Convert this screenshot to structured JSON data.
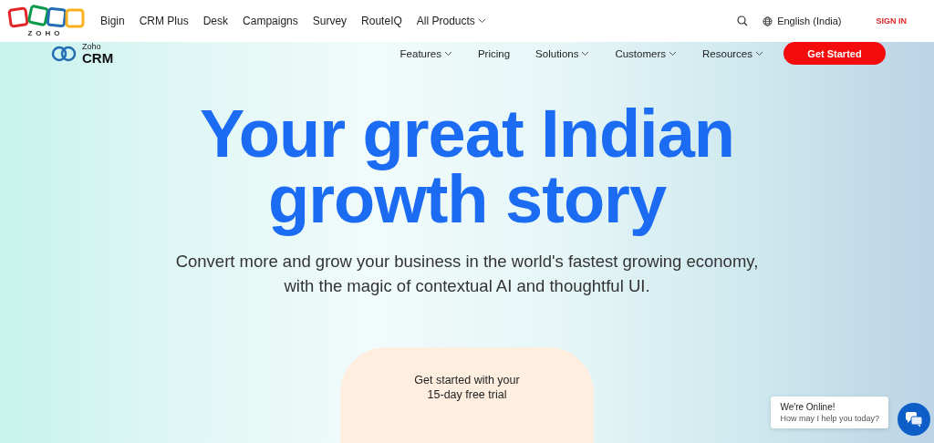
{
  "top_bar": {
    "logo_text": "ZOHO",
    "products": [
      {
        "label": "Bigin",
        "dropdown": false
      },
      {
        "label": "CRM Plus",
        "dropdown": false
      },
      {
        "label": "Desk",
        "dropdown": false
      },
      {
        "label": "Campaigns",
        "dropdown": false
      },
      {
        "label": "Survey",
        "dropdown": false
      },
      {
        "label": "RouteIQ",
        "dropdown": false
      },
      {
        "label": "All Products",
        "dropdown": true
      }
    ],
    "language": "English (India)",
    "sign_in": "SIGN IN"
  },
  "crm_nav": {
    "brand_small": "Zoho",
    "brand_large": "CRM",
    "items": [
      {
        "label": "Features",
        "dropdown": true
      },
      {
        "label": "Pricing",
        "dropdown": false
      },
      {
        "label": "Solutions",
        "dropdown": true
      },
      {
        "label": "Customers",
        "dropdown": true
      },
      {
        "label": "Resources",
        "dropdown": true
      }
    ],
    "cta": "Get Started"
  },
  "hero": {
    "title": "Your great Indian\ngrowth story",
    "subtitle": "Convert more and grow your business in the world's fastest growing economy,\nwith the magic of contextual AI and thoughtful UI.",
    "trial_text": "Get started with your\n15-day free trial"
  },
  "chat": {
    "title": "We're Online!",
    "message": "How may I help you today?"
  }
}
